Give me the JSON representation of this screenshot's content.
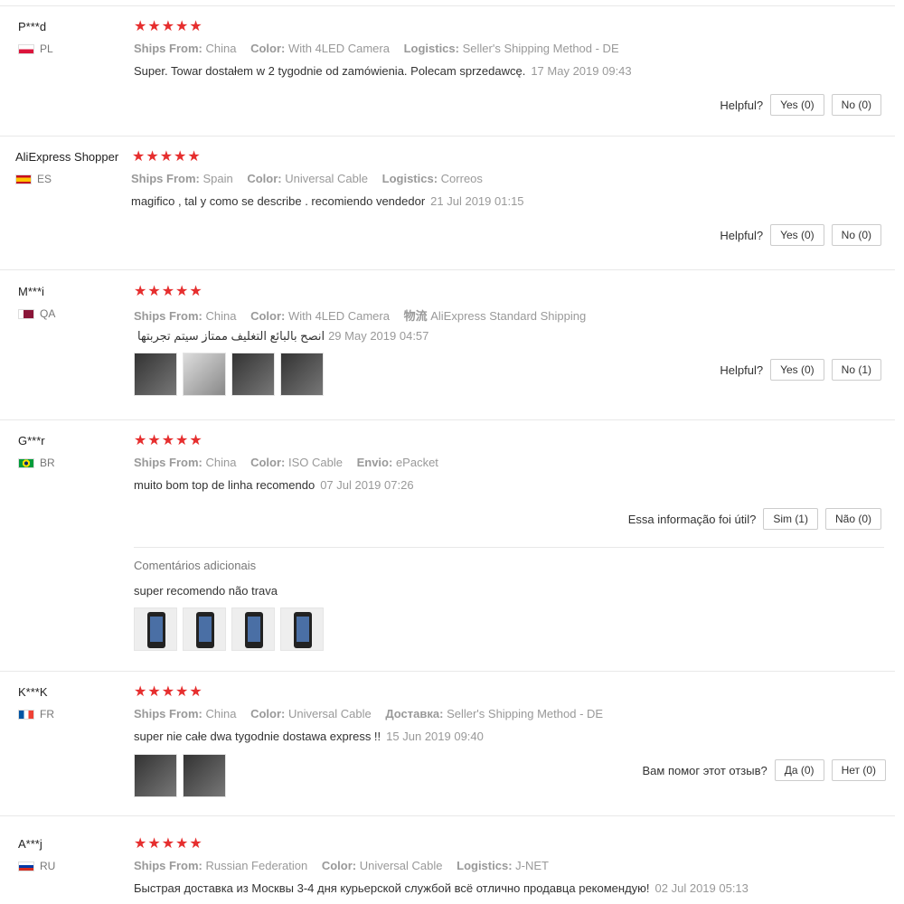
{
  "reviews": [
    {
      "user": "P***d",
      "country": "PL",
      "stars": "★★★★★",
      "ships_label": "Ships From:",
      "ships": "China",
      "color_label": "Color:",
      "color": "With 4LED Camera",
      "logistics_label": "Logistics:",
      "logistics": "Seller's Shipping Method - DE",
      "text": "Super. Towar dostałem w 2 tygodnie od zamówienia. Polecam sprzedawcę.",
      "date": "17 May 2019 09:43",
      "helpful_label": "Helpful?",
      "yes": "Yes (0)",
      "no": "No (0)"
    },
    {
      "user": "AliExpress Shopper",
      "country": "ES",
      "stars": "★★★★★",
      "ships_label": "Ships From:",
      "ships": "Spain",
      "color_label": "Color:",
      "color": "Universal Cable",
      "logistics_label": "Logistics:",
      "logistics": "Correos",
      "text": "magifico , tal y como se describe . recomiendo vendedor",
      "date": "21 Jul 2019 01:15",
      "helpful_label": "Helpful?",
      "yes": "Yes (0)",
      "no": "No (0)"
    },
    {
      "user": "M***i",
      "country": "QA",
      "stars": "★★★★★",
      "ships_label": "Ships From:",
      "ships": "China",
      "color_label": "Color:",
      "color": "With 4LED Camera",
      "logistics_label": "物流",
      "logistics": "AliExpress Standard Shipping",
      "text": "انصح بالبائع التغليف ممتاز سيتم تجربتها",
      "date": "29 May 2019 04:57",
      "helpful_label": "Helpful?",
      "yes": "Yes (0)",
      "no": "No (1)"
    },
    {
      "user": "G***r",
      "country": "BR",
      "stars": "★★★★★",
      "ships_label": "Ships From:",
      "ships": "China",
      "color_label": "Color:",
      "color": "ISO Cable",
      "logistics_label": "Envio:",
      "logistics": "ePacket",
      "text": "muito bom top de linha recomendo",
      "date": "07 Jul 2019 07:26",
      "helpful_label": "Essa informação foi útil?",
      "yes": "Sim (1)",
      "no": "Não (0)",
      "additional_label": "Comentários adicionais",
      "additional_text": "super recomendo não trava"
    },
    {
      "user": "K***K",
      "country": "FR",
      "stars": "★★★★★",
      "ships_label": "Ships From:",
      "ships": "China",
      "color_label": "Color:",
      "color": "Universal Cable",
      "logistics_label": "Доставка:",
      "logistics": "Seller's Shipping Method - DE",
      "text": "super nie całe dwa tygodnie dostawa express !!",
      "date": "15 Jun 2019 09:40",
      "helpful_label": "Вам помог этот отзыв?",
      "yes": "Да (0)",
      "no": "Нет (0)"
    },
    {
      "user": "A***j",
      "country": "RU",
      "stars": "★★★★★",
      "ships_label": "Ships From:",
      "ships": "Russian Federation",
      "color_label": "Color:",
      "color": "Universal Cable",
      "logistics_label": "Logistics:",
      "logistics": "J-NET",
      "text": "Быстрая доставка из Москвы 3-4 дня курьерской службой всё отлично продавца рекомендую!",
      "date": "02 Jul 2019 05:13"
    }
  ],
  "colors": {
    "star": "#e62e2e",
    "meta": "#999999",
    "divider": "#e8e8e8"
  }
}
